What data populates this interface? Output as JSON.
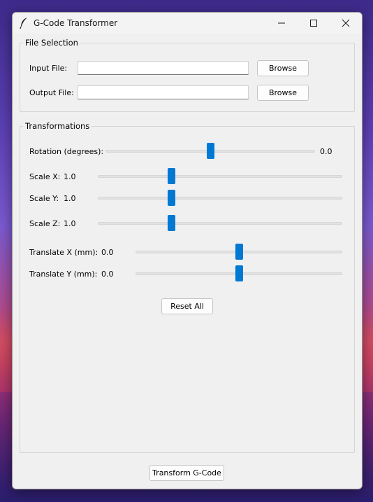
{
  "window": {
    "title": "G-Code Transformer"
  },
  "file_selection": {
    "legend": "File Selection",
    "input_label": "Input File:",
    "input_value": "",
    "output_label": "Output File:",
    "output_value": "",
    "browse_input_label": "Browse",
    "browse_output_label": "Browse"
  },
  "transformations": {
    "legend": "Transformations",
    "rotation": {
      "label": "Rotation (degrees):",
      "value": "0.0",
      "fraction": 0.5
    },
    "scale_x": {
      "label": "Scale X:",
      "value": "1.0",
      "fraction": 0.3
    },
    "scale_y": {
      "label": "Scale Y:",
      "value": "1.0",
      "fraction": 0.3
    },
    "scale_z": {
      "label": "Scale Z:",
      "value": "1.0",
      "fraction": 0.3
    },
    "translate_x": {
      "label": "Translate X (mm):",
      "value": "0.0",
      "fraction": 0.5
    },
    "translate_y": {
      "label": "Translate Y (mm):",
      "value": "0.0",
      "fraction": 0.5
    },
    "reset_label": "Reset All"
  },
  "transform_button_label": "Transform G-Code",
  "colors": {
    "accent": "#0078d4",
    "window_bg": "#f0f0f0"
  },
  "icons": {
    "app": "feather-icon",
    "minimize": "minimize-icon",
    "maximize": "maximize-icon",
    "close": "close-icon"
  }
}
